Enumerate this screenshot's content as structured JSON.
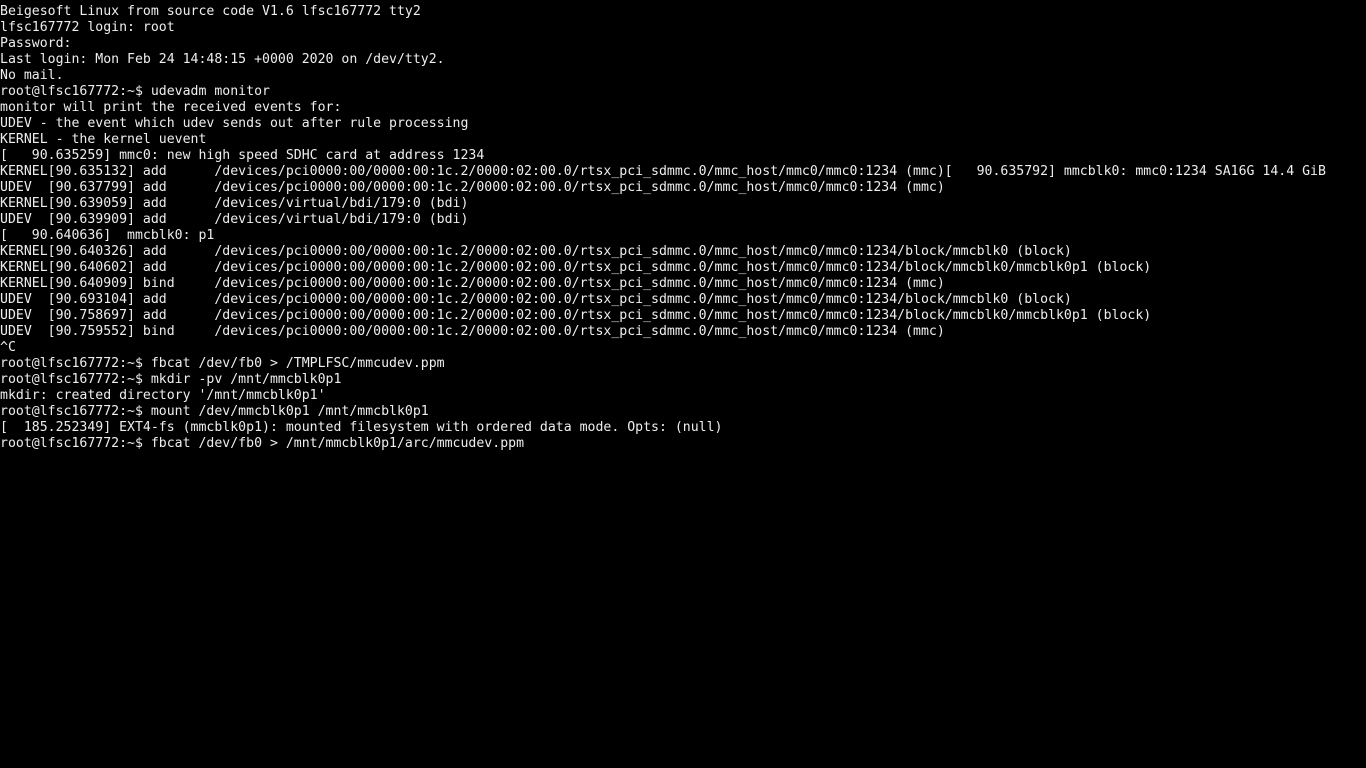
{
  "prompt": "root@lfsc167772:~$ ",
  "lines": [
    "Beigesoft Linux from source code V1.6 lfsc167772 tty2",
    "lfsc167772 login: root",
    "Password:",
    "Last login: Mon Feb 24 14:48:15 +0000 2020 on /dev/tty2.",
    "No mail.",
    "root@lfsc167772:~$ udevadm monitor",
    "monitor will print the received events for:",
    "UDEV - the event which udev sends out after rule processing",
    "KERNEL - the kernel uevent",
    "",
    "[   90.635259] mmc0: new high speed SDHC card at address 1234",
    "KERNEL[90.635132] add      /devices/pci0000:00/0000:00:1c.2/0000:02:00.0/rtsx_pci_sdmmc.0/mmc_host/mmc0/mmc0:1234 (mmc)[   90.635792] mmcblk0: mmc0:1234 SA16G 14.4 GiB",
    "",
    "UDEV  [90.637799] add      /devices/pci0000:00/0000:00:1c.2/0000:02:00.0/rtsx_pci_sdmmc.0/mmc_host/mmc0/mmc0:1234 (mmc)",
    "KERNEL[90.639059] add      /devices/virtual/bdi/179:0 (bdi)",
    "UDEV  [90.639909] add      /devices/virtual/bdi/179:0 (bdi)",
    "[   90.640636]  mmcblk0: p1",
    "KERNEL[90.640326] add      /devices/pci0000:00/0000:00:1c.2/0000:02:00.0/rtsx_pci_sdmmc.0/mmc_host/mmc0/mmc0:1234/block/mmcblk0 (block)",
    "KERNEL[90.640602] add      /devices/pci0000:00/0000:00:1c.2/0000:02:00.0/rtsx_pci_sdmmc.0/mmc_host/mmc0/mmc0:1234/block/mmcblk0/mmcblk0p1 (block)",
    "KERNEL[90.640909] bind     /devices/pci0000:00/0000:00:1c.2/0000:02:00.0/rtsx_pci_sdmmc.0/mmc_host/mmc0/mmc0:1234 (mmc)",
    "UDEV  [90.693104] add      /devices/pci0000:00/0000:00:1c.2/0000:02:00.0/rtsx_pci_sdmmc.0/mmc_host/mmc0/mmc0:1234/block/mmcblk0 (block)",
    "UDEV  [90.758697] add      /devices/pci0000:00/0000:00:1c.2/0000:02:00.0/rtsx_pci_sdmmc.0/mmc_host/mmc0/mmc0:1234/block/mmcblk0/mmcblk0p1 (block)",
    "UDEV  [90.759552] bind     /devices/pci0000:00/0000:00:1c.2/0000:02:00.0/rtsx_pci_sdmmc.0/mmc_host/mmc0/mmc0:1234 (mmc)",
    "^C",
    "root@lfsc167772:~$ fbcat /dev/fb0 > /TMPLFSC/mmcudev.ppm",
    "root@lfsc167772:~$ mkdir -pv /mnt/mmcblk0p1",
    "mkdir: created directory '/mnt/mmcblk0p1'",
    "root@lfsc167772:~$ mount /dev/mmcblk0p1 /mnt/mmcblk0p1",
    "[  185.252349] EXT4-fs (mmcblk0p1): mounted filesystem with ordered data mode. Opts: (null)",
    "root@lfsc167772:~$ fbcat /dev/fb0 > /mnt/mmcblk0p1/arc/mmcudev.ppm"
  ]
}
